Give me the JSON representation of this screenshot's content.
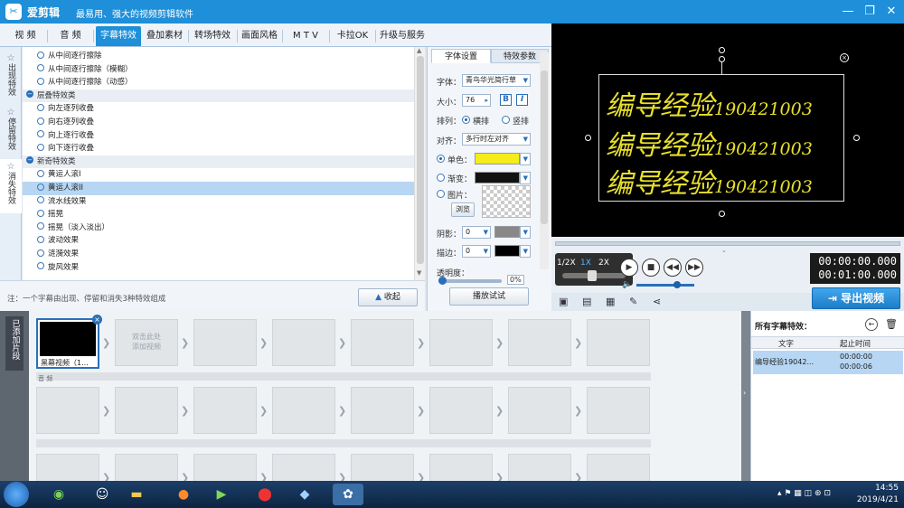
{
  "app": {
    "name": "爱剪辑",
    "slogan": "最易用、强大的视频剪辑软件",
    "window_controls": [
      "—",
      "❐",
      "✕"
    ]
  },
  "tabs": [
    "视  频",
    "音  频",
    "字幕特效",
    "叠加素材",
    "转场特效",
    "画面风格",
    "M T V",
    "卡拉OK",
    "升级与服务"
  ],
  "active_tab": "字幕特效",
  "side_tabs": [
    {
      "label": "出现特效",
      "icon": "star-icon"
    },
    {
      "label": "停留特效",
      "icon": "star-icon"
    },
    {
      "label": "消失特效",
      "icon": "star-icon"
    }
  ],
  "effects_list": [
    {
      "type": "item",
      "label": "从中间逐行擦除"
    },
    {
      "type": "item",
      "label": "从中间逐行擦除（模糊）"
    },
    {
      "type": "item",
      "label": "从中间逐行擦除（动感）"
    },
    {
      "type": "category",
      "label": "层叠特效类"
    },
    {
      "type": "item",
      "label": "向左逐列收叠"
    },
    {
      "type": "item",
      "label": "向右逐列收叠"
    },
    {
      "type": "item",
      "label": "向上逐行收叠"
    },
    {
      "type": "item",
      "label": "向下逐行收叠"
    },
    {
      "type": "category",
      "label": "新奇特效类"
    },
    {
      "type": "item",
      "label": "黄运人滚I"
    },
    {
      "type": "item",
      "label": "黄运人滚II",
      "selected": true
    },
    {
      "type": "item",
      "label": "流水线效果"
    },
    {
      "type": "item",
      "label": "摇晃"
    },
    {
      "type": "item",
      "label": "摇晃（淡入淡出）"
    },
    {
      "type": "item",
      "label": "波动效果"
    },
    {
      "type": "item",
      "label": "涟漪效果"
    },
    {
      "type": "item",
      "label": "旋风效果"
    }
  ],
  "settings": {
    "tabs": [
      "字体设置",
      "特效参数"
    ],
    "font_label": "字体：",
    "font_value": "青鸟华光简行草",
    "size_label": "大小：",
    "size_value": "76",
    "bold": "B",
    "italic": "I",
    "layout_label": "排列：",
    "layout_options": [
      "横排",
      "竖排"
    ],
    "align_label": "对齐：",
    "align_value": "多行时左对齐",
    "solid_label": "单色：",
    "gradient_label": "渐变：",
    "image_label": "图片：",
    "browse_label": "浏览",
    "shadow_label": "阴影：",
    "shadow_value": "0",
    "stroke_label": "描边：",
    "stroke_value": "0",
    "opacity_label": "透明度：",
    "opacity_value": "0%",
    "preview_button": "播放试试",
    "solid_color": "#f5ec1a"
  },
  "note": "注：一个字幕由出现、停留和消失3种特效组成",
  "collapse_button": "收起",
  "preview": {
    "subtitle_lines": [
      {
        "text": "编导经验",
        "num": "190421003"
      },
      {
        "text": "编导经验",
        "num": "190421003"
      },
      {
        "text": "编导经验",
        "num": "190421003"
      }
    ],
    "subtitle_color": "#e8e02a"
  },
  "player": {
    "speeds": [
      "1/2X",
      "1X",
      "2X"
    ],
    "current_time": "00:00:00.000",
    "total_time": "00:01:00.000",
    "volume_level": 0.7
  },
  "export_button": "导出视频",
  "timeline": {
    "side_label": "已添加片段",
    "clip_label": "黑幕视频（1...",
    "placeholder": "双击此处\n添加视频",
    "audio_label": "音  频"
  },
  "subtitle_panel": {
    "title": "所有字幕特效：",
    "col_text": "文字",
    "col_time": "起止时间",
    "rows": [
      {
        "text": "编导经验19042...",
        "start": "00:00:00",
        "end": "00:00:06"
      }
    ]
  },
  "taskbar": {
    "time": "14:55",
    "date": "2019/4/21",
    "items": [
      "start-button",
      "360-icon",
      "qq-icon",
      "explorer-icon",
      "firefox-icon",
      "media-icon",
      "record-icon",
      "app-icon",
      "aijianji-icon"
    ]
  }
}
